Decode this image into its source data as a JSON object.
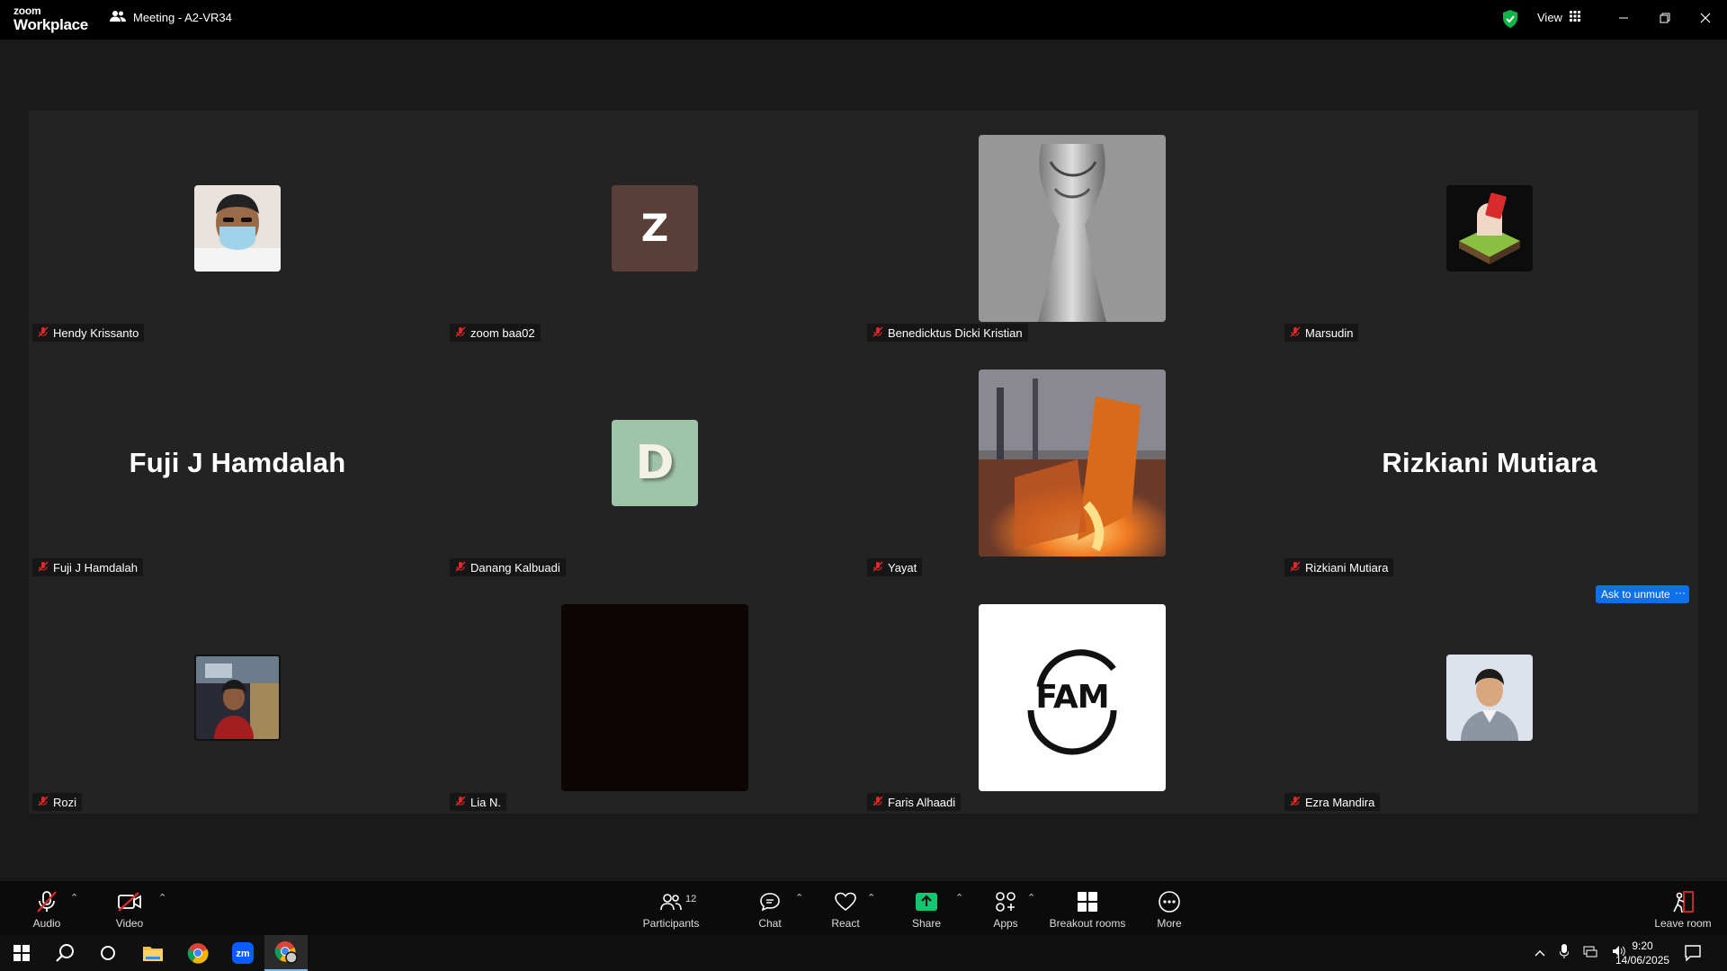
{
  "app": {
    "logo_line1": "zoom",
    "logo_line2": "Workplace",
    "meeting_title": "Meeting - A2-VR34",
    "view_label": "View"
  },
  "colors": {
    "accent_blue": "#0e71eb",
    "share_green": "#12c770",
    "muted_red": "#e02828",
    "shield_green": "#12b34a"
  },
  "participants": [
    {
      "name": "Hendy Krissanto",
      "display": "photo-mask"
    },
    {
      "name": "zoom baa02",
      "display": "letter",
      "letter": "Z"
    },
    {
      "name": "Benedicktus Dicki Kristian",
      "display": "photo-trophy"
    },
    {
      "name": "Marsudin",
      "display": "photo-hand"
    },
    {
      "name": "Fuji J Hamdalah",
      "display": "name",
      "big_name": "Fuji J Hamdalah"
    },
    {
      "name": "Danang Kalbuadi",
      "display": "letter",
      "letter": "D"
    },
    {
      "name": "Yayat",
      "display": "photo-steel"
    },
    {
      "name": "Rizkiani Mutiara",
      "display": "name",
      "big_name": "Rizkiani Mutiara"
    },
    {
      "name": "Rozi",
      "display": "photo-room"
    },
    {
      "name": "Lia N.",
      "display": "video-dark"
    },
    {
      "name": "Faris Alhaadi",
      "display": "logo",
      "logo_text": "FAM"
    },
    {
      "name": "Ezra Mandira",
      "display": "photo-portrait"
    }
  ],
  "ask_unmute": {
    "label": "Ask to unmute",
    "more": "···"
  },
  "toolbar": {
    "audio": "Audio",
    "video": "Video",
    "participants": "Participants",
    "participants_count": "12",
    "chat": "Chat",
    "react": "React",
    "share": "Share",
    "apps": "Apps",
    "breakout": "Breakout rooms",
    "more": "More",
    "leave": "Leave room"
  },
  "taskbar": {
    "time": "9:20",
    "date": "14/06/2025"
  }
}
